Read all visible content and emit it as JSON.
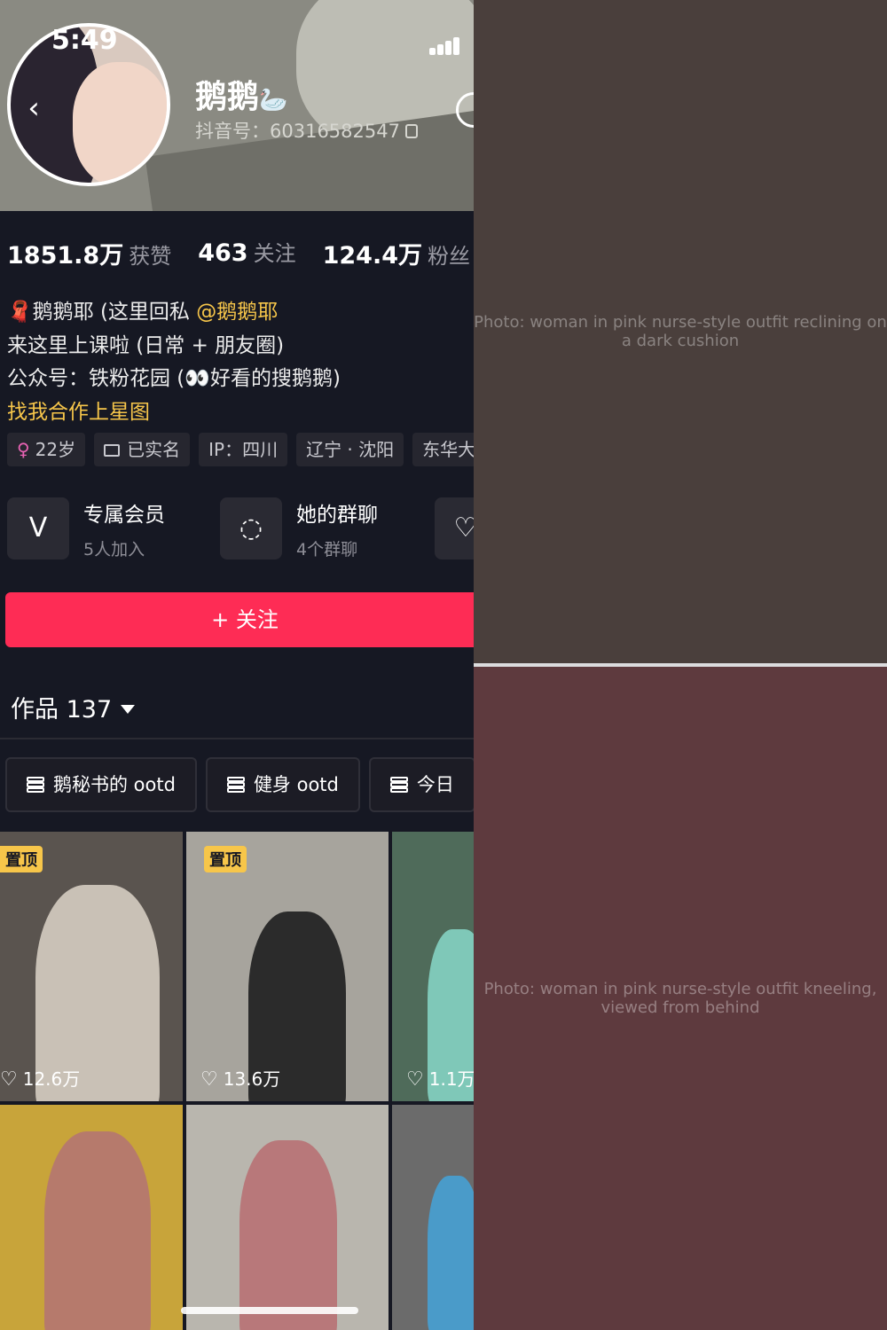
{
  "status": {
    "time": "5:49"
  },
  "profile": {
    "nickname": "鹅鹅",
    "nickname_emoji": "🦢",
    "douyin_id": "抖音号：60316582547"
  },
  "stats": {
    "likes_value": "1851.8万",
    "likes_label": "获赞",
    "following_value": "463",
    "following_label": "关注",
    "followers_value": "124.4万",
    "followers_label": "粉丝"
  },
  "bio": {
    "line1_icon": "🧣",
    "line1_text": "鹅鹅耶 (这里回私 ",
    "line1_mention": "@鹅鹅耶",
    "line2": "来这里上课啦 (日常 + 朋友圈)",
    "line3_prefix": "公众号：铁粉花园 (",
    "line3_eyes": "👀",
    "line3_suffix": "好看的搜鹅鹅)",
    "line4_link": "找我合作上星图"
  },
  "tags": [
    {
      "icon": "♀",
      "text": "22岁"
    },
    {
      "icon": "id-card-icon",
      "text": "已实名"
    },
    {
      "text": "IP：四川"
    },
    {
      "text": "辽宁 · 沈阳"
    },
    {
      "text": "东华大"
    }
  ],
  "features": [
    {
      "icon": "V",
      "title": "专属会员",
      "sub": "5人加入"
    },
    {
      "icon": "◌",
      "title": "她的群聊",
      "sub": "4个群聊"
    }
  ],
  "follow_button": "+ 关注",
  "works": {
    "label": "作品 137"
  },
  "collections": [
    "鹅秘书的 ootd",
    "健身 ootd",
    "今日"
  ],
  "videos": [
    {
      "pinned": "置顶",
      "likes": "12.6万"
    },
    {
      "pinned": "置顶",
      "likes": "13.6万"
    },
    {
      "pinned": "",
      "likes": "1.1万"
    }
  ],
  "photos": [
    {
      "label": "Photo: woman in pink nurse-style outfit reclining on a dark cushion"
    },
    {
      "label": "Photo: woman in pink nurse-style outfit kneeling, viewed from behind"
    }
  ],
  "colors": {
    "accent": "#fe2c55",
    "badge": "#f7c64a",
    "background": "#161823"
  }
}
